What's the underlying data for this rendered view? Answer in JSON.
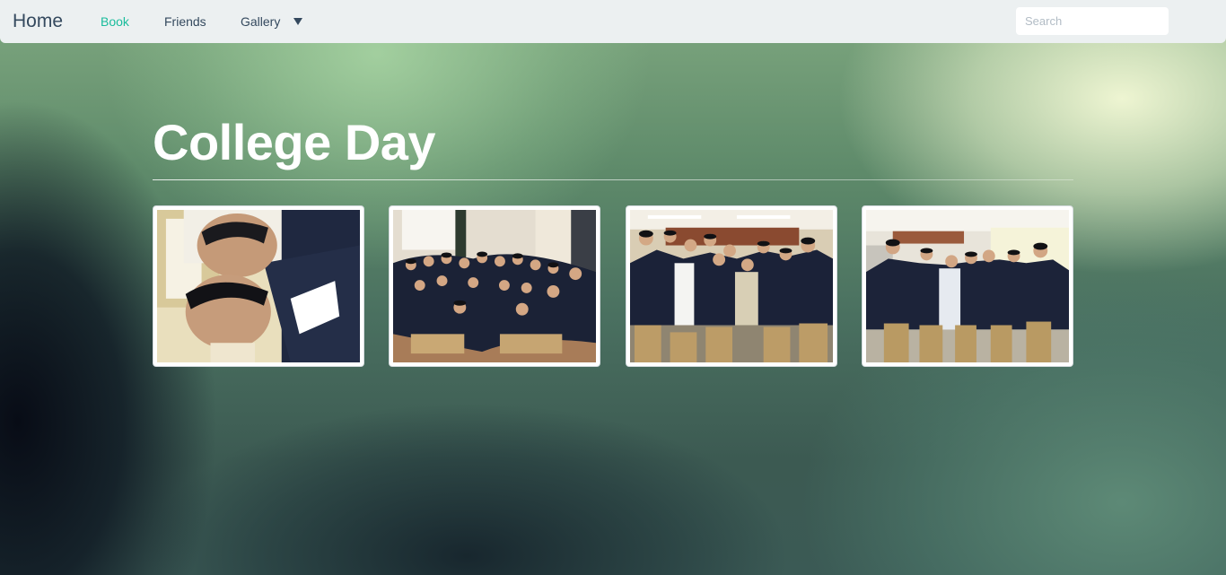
{
  "navbar": {
    "brand": "Home",
    "items": [
      {
        "label": "Book",
        "active": true
      },
      {
        "label": "Friends",
        "active": false
      },
      {
        "label": "Gallery",
        "active": false,
        "has_dropdown": true
      }
    ],
    "search_placeholder": "Search",
    "active_color": "#1abc9c",
    "text_color": "#34495e"
  },
  "main": {
    "title": "College Day"
  },
  "gallery": {
    "thumbnails": [
      {
        "subject": "selfie of two students"
      },
      {
        "subject": "large group of students in corridor"
      },
      {
        "subject": "group of students in classroom"
      },
      {
        "subject": "group of students standing in room"
      }
    ]
  }
}
